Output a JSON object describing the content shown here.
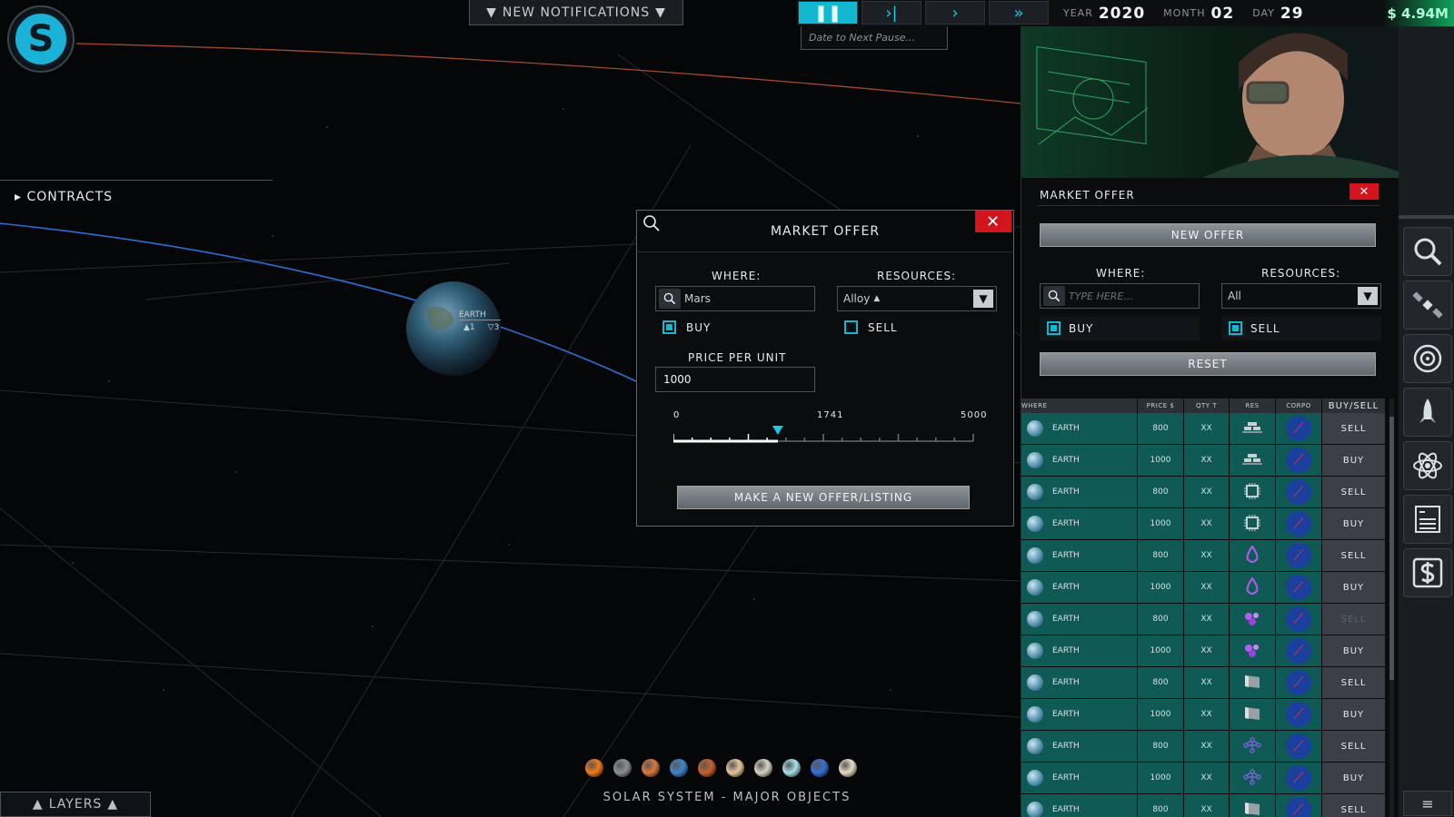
{
  "logo": {
    "letter": "S"
  },
  "notifications": {
    "label": "NEW NOTIFICATIONS"
  },
  "time_controls": {
    "speeds": [
      "pause",
      "step",
      "play",
      "fast"
    ],
    "year_label": "YEAR",
    "year": "2020",
    "month_label": "MONTH",
    "month": "02",
    "day_label": "DAY",
    "day": "29",
    "money": "$ 4.94M",
    "pause_placeholder": "Date to Next Pause..."
  },
  "contracts": {
    "label": "CONTRACTS"
  },
  "map": {
    "earth_label": "EARTH",
    "earth_up": "1",
    "earth_down": "3",
    "footer_label": "SOLAR SYSTEM - MAJOR OBJECTS",
    "planets": [
      "#f07a17",
      "#8c8f94",
      "#d9793a",
      "#3d86c9",
      "#c8622a",
      "#e6c89a",
      "#d8d4c4",
      "#a8e0ea",
      "#3a6fd4",
      "#e8dcc4"
    ]
  },
  "layers": {
    "label": "LAYERS"
  },
  "modal": {
    "title": "MARKET OFFER",
    "where_label": "WHERE:",
    "where_value": "Mars",
    "resources_label": "RESOURCES:",
    "resources_value": "Alloy",
    "buy_label": "BUY",
    "buy_checked": true,
    "sell_label": "SELL",
    "sell_checked": false,
    "price_label": "PRICE PER UNIT",
    "price_value": "1000",
    "slider_min": "0",
    "slider_mid": "1741",
    "slider_max": "5000",
    "slider_value": 1741,
    "slider_max_value": 5000,
    "submit_label": "MAKE A NEW OFFER/LISTING"
  },
  "side_panel": {
    "title": "MARKET OFFER",
    "new_offer_label": "NEW OFFER",
    "where_label": "WHERE:",
    "where_placeholder": "TYPE HERE...",
    "resources_label": "RESOURCES:",
    "resources_value": "All",
    "buy_label": "BUY",
    "sell_label": "SELL",
    "reset_label": "RESET",
    "columns": [
      "WHERE",
      "PRICE $",
      "QTY T",
      "RES",
      "CORPO",
      "BUY/SELL"
    ],
    "rows": [
      {
        "where": "EARTH",
        "price": "800",
        "qty": "XX",
        "res": "alloy-icon",
        "action": "SELL",
        "dim": false
      },
      {
        "where": "EARTH",
        "price": "1000",
        "qty": "XX",
        "res": "alloy-icon",
        "action": "BUY",
        "dim": false
      },
      {
        "where": "EARTH",
        "price": "800",
        "qty": "XX",
        "res": "chip-icon",
        "action": "SELL",
        "dim": false
      },
      {
        "where": "EARTH",
        "price": "1000",
        "qty": "XX",
        "res": "chip-icon",
        "action": "BUY",
        "dim": false
      },
      {
        "where": "EARTH",
        "price": "800",
        "qty": "XX",
        "res": "drop-icon",
        "action": "SELL",
        "dim": false
      },
      {
        "where": "EARTH",
        "price": "1000",
        "qty": "XX",
        "res": "drop-icon",
        "action": "BUY",
        "dim": false
      },
      {
        "where": "EARTH",
        "price": "800",
        "qty": "XX",
        "res": "crystal-icon",
        "action": "SELL",
        "dim": true
      },
      {
        "where": "EARTH",
        "price": "1000",
        "qty": "XX",
        "res": "crystal-icon",
        "action": "BUY",
        "dim": false
      },
      {
        "where": "EARTH",
        "price": "800",
        "qty": "XX",
        "res": "metal-sheet-icon",
        "action": "SELL",
        "dim": false
      },
      {
        "where": "EARTH",
        "price": "1000",
        "qty": "XX",
        "res": "metal-sheet-icon",
        "action": "BUY",
        "dim": false
      },
      {
        "where": "EARTH",
        "price": "800",
        "qty": "XX",
        "res": "molecule-icon",
        "action": "SELL",
        "dim": false
      },
      {
        "where": "EARTH",
        "price": "1000",
        "qty": "XX",
        "res": "molecule-icon",
        "action": "BUY",
        "dim": false
      },
      {
        "where": "EARTH",
        "price": "800",
        "qty": "XX",
        "res": "metal-sheet-icon",
        "action": "SELL",
        "dim": false
      }
    ]
  },
  "rail": [
    "search-icon",
    "satellite-icon",
    "orbit-icon",
    "rocket-icon",
    "atom-icon",
    "ledger-icon",
    "money-icon"
  ]
}
